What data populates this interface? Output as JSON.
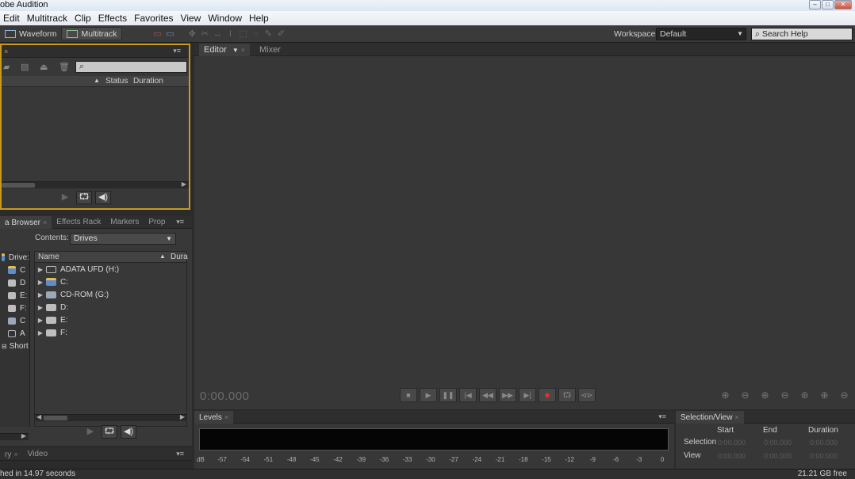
{
  "window": {
    "title": "obe Audition"
  },
  "menubar": {
    "items": [
      "Edit",
      "Multitrack",
      "Clip",
      "Effects",
      "Favorites",
      "View",
      "Window",
      "Help"
    ]
  },
  "toolbar": {
    "waveform_label": "Waveform",
    "multitrack_label": "Multitrack",
    "workspace_label": "Workspace:",
    "workspace_value": "Default",
    "search_placeholder": "Search Help"
  },
  "files_panel": {
    "search_glyph": "⌕",
    "columns": {
      "status": "Status",
      "duration": "Duration"
    }
  },
  "media_panel": {
    "tabs": {
      "media_browser": "a Browser",
      "effects_rack": "Effects Rack",
      "markers": "Markers",
      "properties": "Prop"
    },
    "contents_label": "Contents:",
    "contents_value": "Drives",
    "left_items": [
      "Drive:",
      "C",
      "D",
      "E:",
      "F:",
      "C",
      "A",
      "Short"
    ],
    "list_header": {
      "name": "Name",
      "duration": "Dura"
    },
    "drives": [
      {
        "label": "ADATA UFD (H:)",
        "type": "usb"
      },
      {
        "label": "C:",
        "type": "sys"
      },
      {
        "label": "CD-ROM (G:)",
        "type": "cd"
      },
      {
        "label": "D:",
        "type": "hdd"
      },
      {
        "label": "E:",
        "type": "hdd"
      },
      {
        "label": "F:",
        "type": "hdd"
      }
    ]
  },
  "bottom_tabs": {
    "history": "ry",
    "video": "Video"
  },
  "editor": {
    "tabs": {
      "editor": "Editor",
      "mixer": "Mixer"
    },
    "timecode": "0:00.000"
  },
  "levels": {
    "tab": "Levels",
    "scale_unit": "dB",
    "scale": [
      "-57",
      "-54",
      "-51",
      "-48",
      "-45",
      "-42",
      "-39",
      "-36",
      "-33",
      "-30",
      "-27",
      "-24",
      "-21",
      "-18",
      "-15",
      "-12",
      "-9",
      "-6",
      "-3",
      "0"
    ]
  },
  "selection_view": {
    "tab": "Selection/View",
    "columns": {
      "start": "Start",
      "end": "End",
      "duration": "Duration"
    },
    "rows": [
      {
        "label": "Selection",
        "start": "0:00.000",
        "end": "0:00.000",
        "duration": "0:00.000"
      },
      {
        "label": "View",
        "start": "0:00.000",
        "end": "0:00.000",
        "duration": "0:00.000"
      }
    ]
  },
  "status": {
    "left": "hed in 14.97 seconds",
    "right": "21.21 GB free"
  },
  "colors": {
    "accent_border": "#c89b1e",
    "record": "#e03030",
    "panel_bg": "#383838"
  }
}
